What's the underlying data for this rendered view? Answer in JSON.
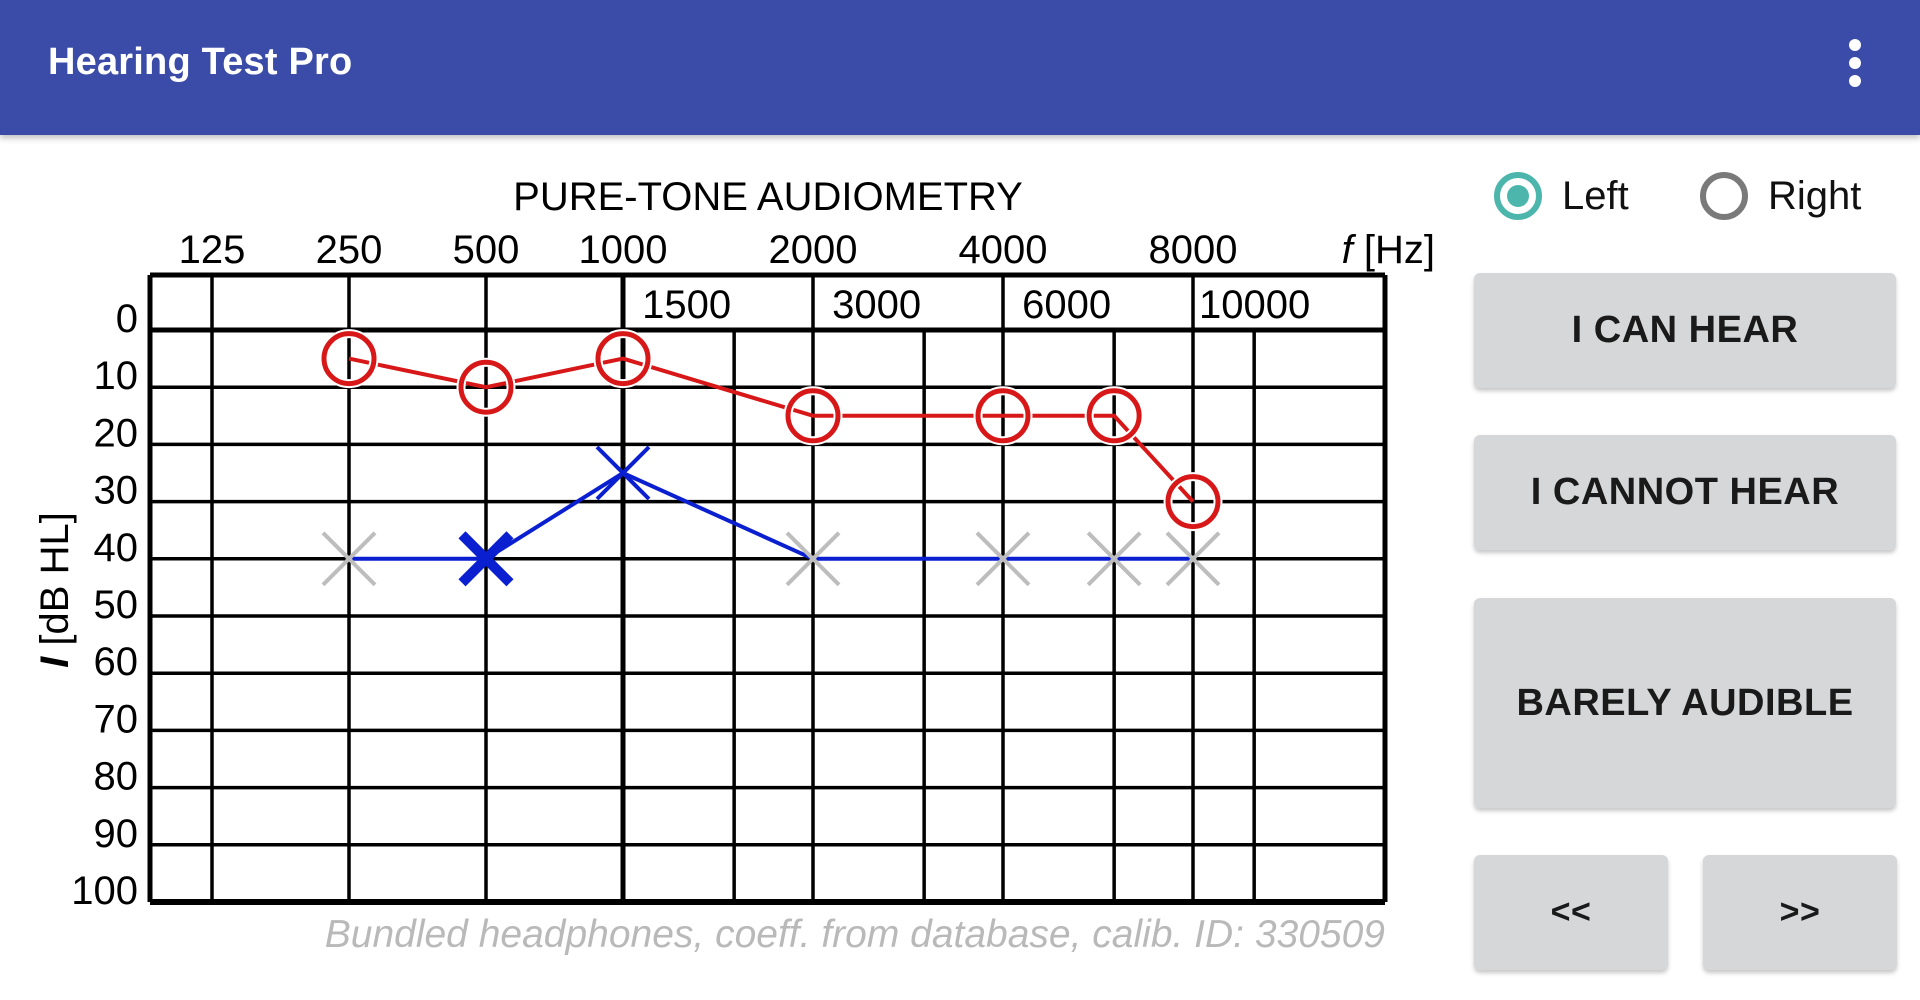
{
  "appbar": {
    "title": "Hearing Test Pro",
    "menu_icon": "more-vert-icon"
  },
  "ear_selector": {
    "options": [
      {
        "label": "Left",
        "checked": true
      },
      {
        "label": "Right",
        "checked": false
      }
    ],
    "accent_color": "#4db6ac"
  },
  "buttons": {
    "can_hear": "I CAN HEAR",
    "cannot_hear": "I CANNOT HEAR",
    "barely_audible": "BARELY AUDIBLE",
    "previous": "<<",
    "next": ">>"
  },
  "chart_data": {
    "type": "line",
    "title": "PURE-TONE AUDIOMETRY",
    "xlabel_var": "f",
    "xlabel_unit": "[Hz]",
    "ylabel_var": "I",
    "ylabel_unit": "[dB HL]",
    "x_scale": "log2",
    "x_primary_ticks": [
      125,
      250,
      500,
      1000,
      2000,
      4000,
      8000
    ],
    "x_secondary_ticks": [
      1500,
      3000,
      6000,
      10000
    ],
    "x_range": [
      105,
      16000
    ],
    "y_ticks": [
      0,
      10,
      20,
      30,
      40,
      50,
      60,
      70,
      80,
      90,
      100
    ],
    "ylim": [
      -10,
      100
    ],
    "y_inverted": true,
    "grid": true,
    "footer": "Bundled headphones, coeff. from database, calib. ID: 330509",
    "series": [
      {
        "name": "Right ear",
        "marker": "circle",
        "color": "#d81818",
        "points": [
          {
            "x": 250,
            "y": 5
          },
          {
            "x": 500,
            "y": 10
          },
          {
            "x": 1000,
            "y": 5
          },
          {
            "x": 2000,
            "y": 15
          },
          {
            "x": 4000,
            "y": 15
          },
          {
            "x": 6000,
            "y": 15
          },
          {
            "x": 8000,
            "y": 30
          }
        ]
      },
      {
        "name": "Left ear",
        "marker": "cross",
        "color": "#0a1fd0",
        "untested_color": "#bdbdbd",
        "points": [
          {
            "x": 250,
            "y": 40,
            "state": "untested"
          },
          {
            "x": 500,
            "y": 40,
            "state": "current"
          },
          {
            "x": 1000,
            "y": 25,
            "state": "measured"
          },
          {
            "x": 2000,
            "y": 40,
            "state": "untested"
          },
          {
            "x": 4000,
            "y": 40,
            "state": "untested"
          },
          {
            "x": 6000,
            "y": 40,
            "state": "untested"
          },
          {
            "x": 8000,
            "y": 40,
            "state": "untested"
          }
        ]
      }
    ]
  }
}
